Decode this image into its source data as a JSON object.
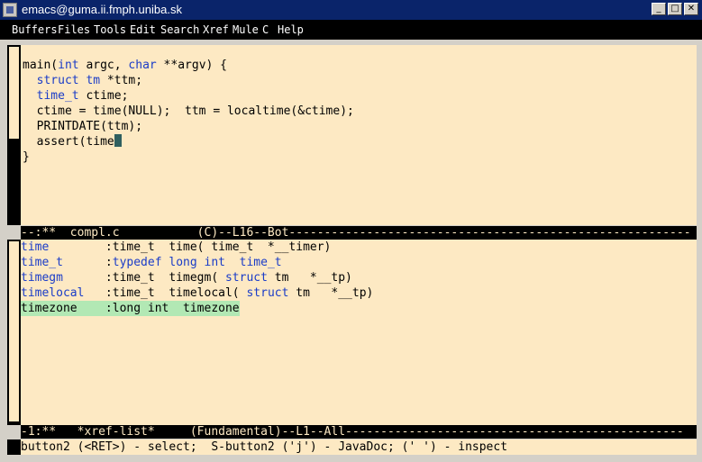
{
  "window": {
    "title": "emacs@guma.ii.fmph.uniba.sk",
    "buttons": [
      "_",
      "□",
      "✕"
    ]
  },
  "menu": [
    "Buffers",
    "Files",
    "Tools",
    "Edit",
    "Search",
    "Xref",
    "Mule",
    "C",
    "Help"
  ],
  "code": [
    [
      {
        "t": "main(",
        "k": false
      },
      {
        "t": "int",
        "k": true
      },
      {
        "t": " argc, ",
        "k": false
      },
      {
        "t": "char",
        "k": true
      },
      {
        "t": " **argv) {",
        "k": false
      }
    ],
    [
      {
        "t": "  ",
        "k": false
      },
      {
        "t": "struct",
        "k": true
      },
      {
        "t": " ",
        "k": false
      },
      {
        "t": "tm",
        "k": true
      },
      {
        "t": " *ttm;",
        "k": false
      }
    ],
    [
      {
        "t": "  ",
        "k": false
      },
      {
        "t": "time_t",
        "k": true
      },
      {
        "t": " ctime;",
        "k": false
      }
    ],
    [
      {
        "t": "  ctime = time(NULL);  ttm = localtime(&ctime);",
        "k": false
      }
    ],
    [
      {
        "t": "  PRINTDATE(ttm);",
        "k": false
      }
    ],
    [
      {
        "t": "  assert(time",
        "k": false
      }
    ],
    [
      {
        "t": "}",
        "k": false
      }
    ]
  ],
  "modeline1": "--:**  compl.c           (C)--L16--Bot---------------------------------------------------------",
  "xref_rows": [
    [
      {
        "t": "time       ",
        "k": true
      },
      {
        "t": " :time_t  time( time_t  *__timer)",
        "k": false
      }
    ],
    [
      {
        "t": "time_t     ",
        "k": true
      },
      {
        "t": " :",
        "k": false
      },
      {
        "t": "typedef",
        "k": true
      },
      {
        "t": " ",
        "k": false
      },
      {
        "t": "long",
        "k": true
      },
      {
        "t": " ",
        "k": false
      },
      {
        "t": "int",
        "k": true
      },
      {
        "t": "  ",
        "k": false
      },
      {
        "t": "time_t",
        "k": true
      }
    ],
    [
      {
        "t": "timegm     ",
        "k": true
      },
      {
        "t": " :time_t  timegm( ",
        "k": false
      },
      {
        "t": "struct",
        "k": true
      },
      {
        "t": " tm   *__tp)",
        "k": false
      }
    ],
    [
      {
        "t": "timelocal  ",
        "k": true
      },
      {
        "t": " :time_t  timelocal( ",
        "k": false
      },
      {
        "t": "struct",
        "k": true
      },
      {
        "t": " tm   *__tp)",
        "k": false
      }
    ],
    [
      {
        "t": "timezone   ",
        "k": false
      },
      {
        "t": " :long int  timezone",
        "k": false
      }
    ]
  ],
  "modeline2": "-1:**   *xref-list*     (Fundamental)--L1--All------------------------------------------------",
  "minibuffer": "button2 (<RET>) - select;  S-button2 ('j') - JavaDoc; (' ') - inspect"
}
